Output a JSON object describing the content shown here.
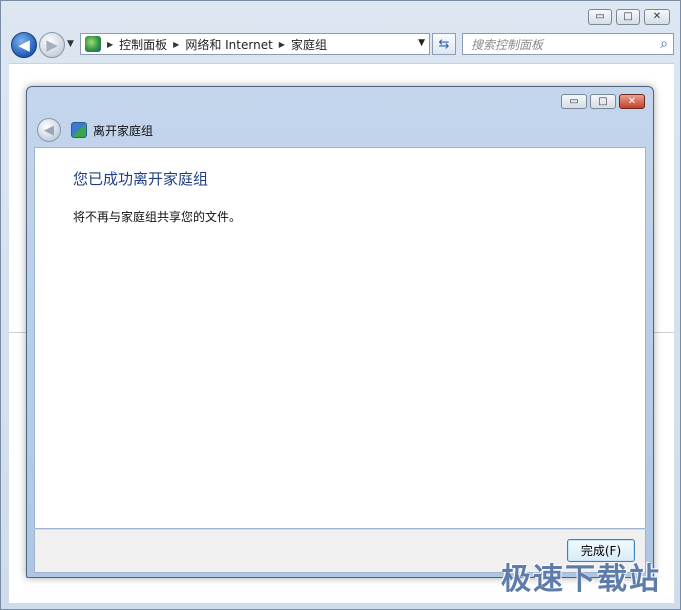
{
  "outer_window": {
    "caption_buttons": {
      "minimize": "▭",
      "maximize": "□",
      "close": "✕"
    },
    "address": {
      "crumbs": [
        "控制面板",
        "网络和 Internet",
        "家庭组"
      ]
    },
    "search": {
      "placeholder": "搜索控制面板"
    }
  },
  "dialog": {
    "caption_buttons": {
      "minimize": "▭",
      "maximize": "□",
      "close": "✕"
    },
    "title": "离开家庭组",
    "heading": "您已成功离开家庭组",
    "description": "将不再与家庭组共享您的文件。",
    "finish_button": "完成(F)"
  },
  "watermark": "极速下载站",
  "colors": {
    "heading": "#1f3f85",
    "button_border": "#3c7fb1",
    "close_button": "#c4402a"
  }
}
